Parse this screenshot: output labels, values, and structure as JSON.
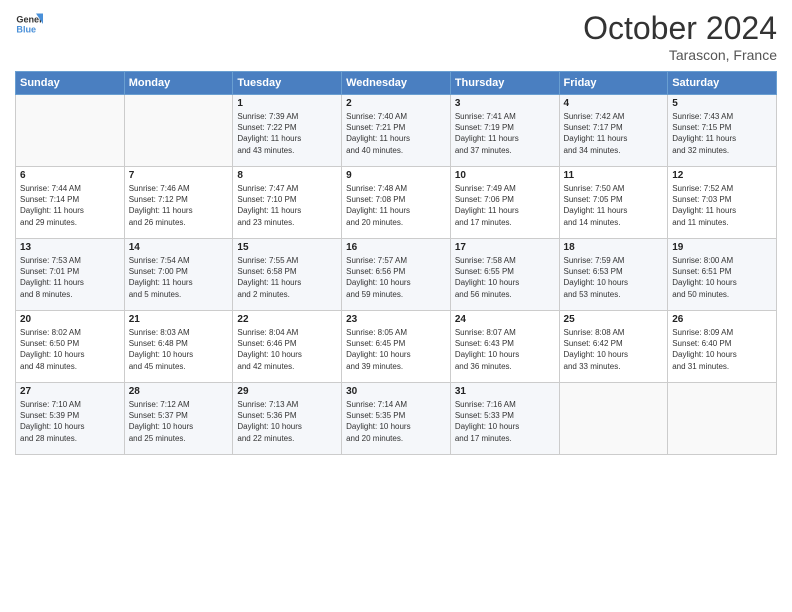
{
  "header": {
    "title": "October 2024",
    "subtitle": "Tarascon, France"
  },
  "days": [
    "Sunday",
    "Monday",
    "Tuesday",
    "Wednesday",
    "Thursday",
    "Friday",
    "Saturday"
  ],
  "weeks": [
    [
      {
        "day": "",
        "info": ""
      },
      {
        "day": "",
        "info": ""
      },
      {
        "day": "1",
        "info": "Sunrise: 7:39 AM\nSunset: 7:22 PM\nDaylight: 11 hours\nand 43 minutes."
      },
      {
        "day": "2",
        "info": "Sunrise: 7:40 AM\nSunset: 7:21 PM\nDaylight: 11 hours\nand 40 minutes."
      },
      {
        "day": "3",
        "info": "Sunrise: 7:41 AM\nSunset: 7:19 PM\nDaylight: 11 hours\nand 37 minutes."
      },
      {
        "day": "4",
        "info": "Sunrise: 7:42 AM\nSunset: 7:17 PM\nDaylight: 11 hours\nand 34 minutes."
      },
      {
        "day": "5",
        "info": "Sunrise: 7:43 AM\nSunset: 7:15 PM\nDaylight: 11 hours\nand 32 minutes."
      }
    ],
    [
      {
        "day": "6",
        "info": "Sunrise: 7:44 AM\nSunset: 7:14 PM\nDaylight: 11 hours\nand 29 minutes."
      },
      {
        "day": "7",
        "info": "Sunrise: 7:46 AM\nSunset: 7:12 PM\nDaylight: 11 hours\nand 26 minutes."
      },
      {
        "day": "8",
        "info": "Sunrise: 7:47 AM\nSunset: 7:10 PM\nDaylight: 11 hours\nand 23 minutes."
      },
      {
        "day": "9",
        "info": "Sunrise: 7:48 AM\nSunset: 7:08 PM\nDaylight: 11 hours\nand 20 minutes."
      },
      {
        "day": "10",
        "info": "Sunrise: 7:49 AM\nSunset: 7:06 PM\nDaylight: 11 hours\nand 17 minutes."
      },
      {
        "day": "11",
        "info": "Sunrise: 7:50 AM\nSunset: 7:05 PM\nDaylight: 11 hours\nand 14 minutes."
      },
      {
        "day": "12",
        "info": "Sunrise: 7:52 AM\nSunset: 7:03 PM\nDaylight: 11 hours\nand 11 minutes."
      }
    ],
    [
      {
        "day": "13",
        "info": "Sunrise: 7:53 AM\nSunset: 7:01 PM\nDaylight: 11 hours\nand 8 minutes."
      },
      {
        "day": "14",
        "info": "Sunrise: 7:54 AM\nSunset: 7:00 PM\nDaylight: 11 hours\nand 5 minutes."
      },
      {
        "day": "15",
        "info": "Sunrise: 7:55 AM\nSunset: 6:58 PM\nDaylight: 11 hours\nand 2 minutes."
      },
      {
        "day": "16",
        "info": "Sunrise: 7:57 AM\nSunset: 6:56 PM\nDaylight: 10 hours\nand 59 minutes."
      },
      {
        "day": "17",
        "info": "Sunrise: 7:58 AM\nSunset: 6:55 PM\nDaylight: 10 hours\nand 56 minutes."
      },
      {
        "day": "18",
        "info": "Sunrise: 7:59 AM\nSunset: 6:53 PM\nDaylight: 10 hours\nand 53 minutes."
      },
      {
        "day": "19",
        "info": "Sunrise: 8:00 AM\nSunset: 6:51 PM\nDaylight: 10 hours\nand 50 minutes."
      }
    ],
    [
      {
        "day": "20",
        "info": "Sunrise: 8:02 AM\nSunset: 6:50 PM\nDaylight: 10 hours\nand 48 minutes."
      },
      {
        "day": "21",
        "info": "Sunrise: 8:03 AM\nSunset: 6:48 PM\nDaylight: 10 hours\nand 45 minutes."
      },
      {
        "day": "22",
        "info": "Sunrise: 8:04 AM\nSunset: 6:46 PM\nDaylight: 10 hours\nand 42 minutes."
      },
      {
        "day": "23",
        "info": "Sunrise: 8:05 AM\nSunset: 6:45 PM\nDaylight: 10 hours\nand 39 minutes."
      },
      {
        "day": "24",
        "info": "Sunrise: 8:07 AM\nSunset: 6:43 PM\nDaylight: 10 hours\nand 36 minutes."
      },
      {
        "day": "25",
        "info": "Sunrise: 8:08 AM\nSunset: 6:42 PM\nDaylight: 10 hours\nand 33 minutes."
      },
      {
        "day": "26",
        "info": "Sunrise: 8:09 AM\nSunset: 6:40 PM\nDaylight: 10 hours\nand 31 minutes."
      }
    ],
    [
      {
        "day": "27",
        "info": "Sunrise: 7:10 AM\nSunset: 5:39 PM\nDaylight: 10 hours\nand 28 minutes."
      },
      {
        "day": "28",
        "info": "Sunrise: 7:12 AM\nSunset: 5:37 PM\nDaylight: 10 hours\nand 25 minutes."
      },
      {
        "day": "29",
        "info": "Sunrise: 7:13 AM\nSunset: 5:36 PM\nDaylight: 10 hours\nand 22 minutes."
      },
      {
        "day": "30",
        "info": "Sunrise: 7:14 AM\nSunset: 5:35 PM\nDaylight: 10 hours\nand 20 minutes."
      },
      {
        "day": "31",
        "info": "Sunrise: 7:16 AM\nSunset: 5:33 PM\nDaylight: 10 hours\nand 17 minutes."
      },
      {
        "day": "",
        "info": ""
      },
      {
        "day": "",
        "info": ""
      }
    ]
  ]
}
